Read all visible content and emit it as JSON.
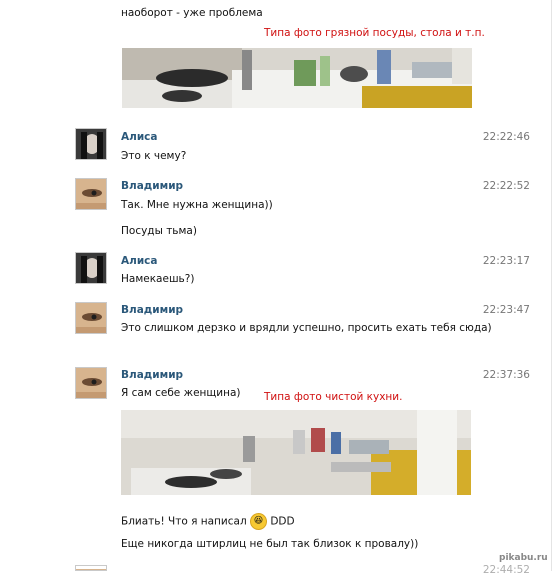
{
  "top_text": "наоборот - уже проблема",
  "messages": [
    {
      "name": "Алиса",
      "time": "22:22:46",
      "lines": [
        "Это к чему?"
      ]
    },
    {
      "name": "Владимир",
      "time": "22:22:52",
      "lines": [
        "Так. Мне нужна женщина))",
        "Посуды тьма)"
      ]
    },
    {
      "name": "Алиса",
      "time": "22:23:17",
      "lines": [
        "Намекаешь?)"
      ]
    },
    {
      "name": "Владимир",
      "time": "22:23:47",
      "lines": [
        "Это слишком дерзко и врядли успешно, просить ехать тебя сюда)"
      ]
    },
    {
      "name": "Владимир",
      "time": "22:37:36",
      "lines": [
        "Я сам себе женщина)"
      ]
    }
  ],
  "final_lines": [
    "Блиать! Что я написал ",
    "DDD",
    "Еще никогда штирлиц не был так близок к провалу))"
  ],
  "captions": {
    "dirty": "Типа фото грязной посуды, стола и т.п.",
    "clean": "Типа фото чистой кухни."
  },
  "bottom_time": "22:44:52",
  "watermark": "pikabu.ru",
  "icons": {
    "emoji": "laughing-face-icon"
  }
}
